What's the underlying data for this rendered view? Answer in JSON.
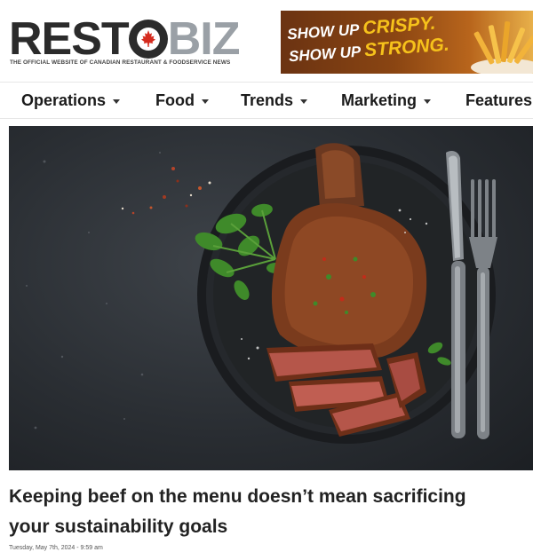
{
  "site": {
    "logo_part1": "REST",
    "logo_part2": "BIZ",
    "tagline": "THE OFFICIAL WEBSITE OF CANADIAN RESTAURANT & FOODSERVICE NEWS"
  },
  "ad": {
    "line1_prefix": "SHOW UP",
    "line1_highlight": "CRISPY.",
    "line2_prefix": "SHOW UP",
    "line2_highlight": "STRONG."
  },
  "nav": {
    "items": [
      {
        "label": "Operations"
      },
      {
        "label": "Food"
      },
      {
        "label": "Trends"
      },
      {
        "label": "Marketing"
      },
      {
        "label": "Features"
      }
    ]
  },
  "article": {
    "title_line1": "Keeping beef on the menu doesn’t mean sacrificing",
    "title_line2": "your sustainability goals",
    "date": "Tuesday, May 7th, 2024 - 9:59 am"
  },
  "colors": {
    "logo_dark": "#2b2b2b",
    "logo_light": "#9aa0a6",
    "maple_red": "#d52b1e",
    "ad_highlight": "#f6c21b"
  }
}
